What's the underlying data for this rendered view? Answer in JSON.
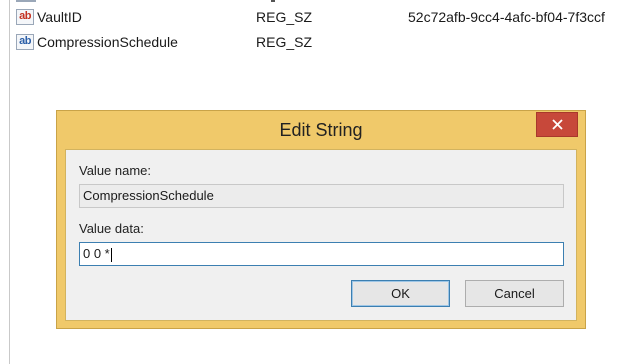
{
  "registry_list": {
    "rows": [
      {
        "icon": "ab",
        "name": "VaultID",
        "type": "REG_SZ",
        "data": "52c72afb-9cc4-4afc-bf04-7f3ccf"
      },
      {
        "icon": "ab",
        "name": "CompressionSchedule",
        "type": "REG_SZ",
        "data": ""
      }
    ]
  },
  "dialog": {
    "title": "Edit String",
    "value_name_label": "Value name:",
    "value_name": "CompressionSchedule",
    "value_data_label": "Value data:",
    "value_data": "0 0 *",
    "ok_label": "OK",
    "cancel_label": "Cancel",
    "colors": {
      "frame": "#f0c96a",
      "close_button": "#c7483a",
      "focus_border": "#3c7fb1"
    }
  }
}
